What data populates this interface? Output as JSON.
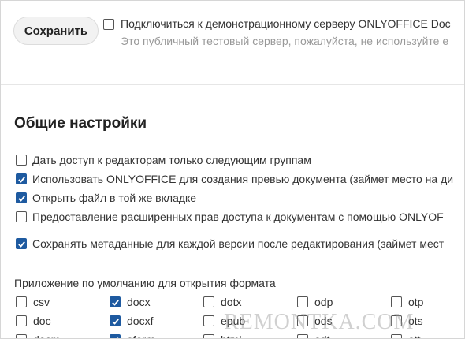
{
  "toolbar": {
    "save_label": "Сохранить"
  },
  "demo": {
    "label": "Подключиться к демонстрационному серверу ONLYOFFICE Doc",
    "hint": "Это публичный тестовый сервер, пожалуйста, не используйте е",
    "checked": false
  },
  "general": {
    "title": "Общие настройки",
    "options": [
      {
        "label": "Дать доступ к редакторам только следующим группам",
        "checked": false
      },
      {
        "label": "Использовать ONLYOFFICE для создания превью документа (займет место на ди",
        "checked": true
      },
      {
        "label": "Открыть файл в той же вкладке",
        "checked": true
      },
      {
        "label": "Предоставление расширенных прав доступа к документам с помощью ONLYOF",
        "checked": false
      },
      {
        "label": "Сохранять метаданные для каждой версии после редактирования (займет мест",
        "checked": true
      }
    ]
  },
  "formats": {
    "title": "Приложение по умолчанию для открытия формата",
    "items": [
      {
        "label": "csv",
        "checked": false
      },
      {
        "label": "docx",
        "checked": true
      },
      {
        "label": "dotx",
        "checked": false
      },
      {
        "label": "odp",
        "checked": false
      },
      {
        "label": "otp",
        "checked": false
      },
      {
        "label": "doc",
        "checked": false
      },
      {
        "label": "docxf",
        "checked": true
      },
      {
        "label": "epub",
        "checked": false
      },
      {
        "label": "ods",
        "checked": false
      },
      {
        "label": "ots",
        "checked": false
      },
      {
        "label": "docm",
        "checked": false
      },
      {
        "label": "oform",
        "checked": true
      },
      {
        "label": "html",
        "checked": false
      },
      {
        "label": "odt",
        "checked": false
      },
      {
        "label": "ott",
        "checked": false
      }
    ]
  },
  "watermark": "REMONTKA.COM"
}
